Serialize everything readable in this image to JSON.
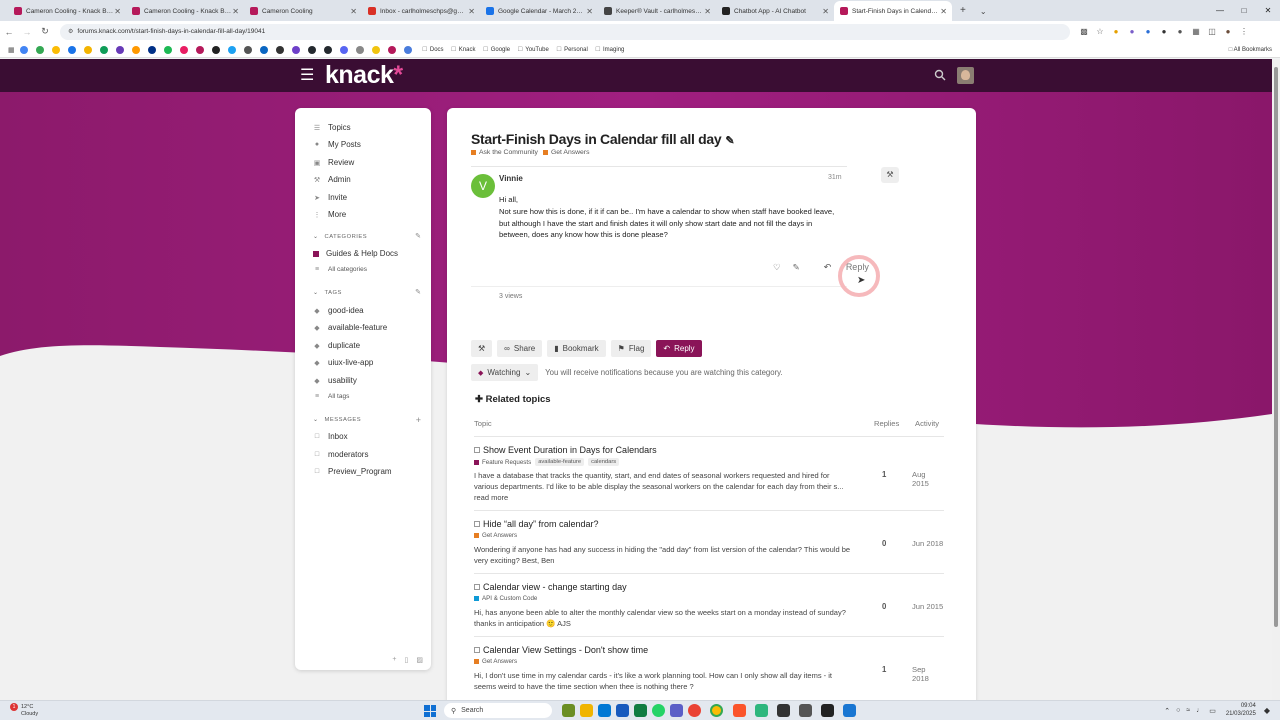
{
  "browser": {
    "tabs": [
      {
        "title": "Cameron Cooling - Knack Buil...",
        "color": "#b5195a"
      },
      {
        "title": "Cameron Cooling - Knack Buil...",
        "color": "#b5195a"
      },
      {
        "title": "Cameron Cooling",
        "color": "#b5195a"
      },
      {
        "title": "Inbox - carlholmeschps@gmail...",
        "color": "#d93025"
      },
      {
        "title": "Google Calendar - March 2025",
        "color": "#1a73e8"
      },
      {
        "title": "Keeper® Vault - carlholmeschp...",
        "color": "#444"
      },
      {
        "title": "Chatbot App - AI Chatbot",
        "color": "#222"
      },
      {
        "title": "Start-Finish Days in Calendar fill",
        "color": "#b5195a"
      }
    ],
    "url": "forums.knack.com/t/start-finish-days-in-calendar-fill-all-day/19041",
    "bookmarks": [
      "Docs",
      "Knack",
      "Google",
      "YouTube",
      "Personal",
      "Imaging"
    ],
    "all_bookmarks": "All Bookmarks"
  },
  "header": {
    "logo": "knack",
    "logo_star": "*"
  },
  "sidebar": {
    "nav": [
      "Topics",
      "My Posts",
      "Review",
      "Admin",
      "Invite",
      "More"
    ],
    "categories_heading": "CATEGORIES",
    "categories": [
      "Guides & Help Docs"
    ],
    "all_categories": "All categories",
    "tags_heading": "TAGS",
    "tags": [
      "good-idea",
      "available-feature",
      "duplicate",
      "uiux-live-app",
      "usability"
    ],
    "all_tags": "All tags",
    "messages_heading": "MESSAGES",
    "messages": [
      "Inbox",
      "moderators",
      "Preview_Program"
    ]
  },
  "topic": {
    "title": "Start-Finish Days in Calendar fill all day",
    "category": "Ask the Community",
    "subcategory": "Get Answers",
    "category_color": "#e67e22",
    "post": {
      "author": "Vinnie",
      "avatar_letter": "V",
      "time": "31m",
      "greeting": "Hi all,",
      "body": "Not sure how this is done, if it if can be.. I'm have a calendar to show when staff have booked leave, but although I have the start and finish dates it will only show start date and not fill the days in between, does any know how this is done please?",
      "reply_label": "Reply",
      "views": "3 views"
    },
    "buttons": {
      "share": "Share",
      "bookmark": "Bookmark",
      "flag": "Flag",
      "reply": "Reply"
    },
    "watching_label": "Watching",
    "watching_text": "You will receive notifications because you are watching this category."
  },
  "related": {
    "heading": "Related topics",
    "columns": {
      "topic": "Topic",
      "replies": "Replies",
      "activity": "Activity"
    },
    "rows": [
      {
        "title": "Show Event Duration in Days for Calendars",
        "category": "Feature Requests",
        "cat_color": "#8a1458",
        "tags": [
          "available-feature",
          "calendars"
        ],
        "excerpt": "I have a database that tracks the quantity, start, and end dates of seasonal workers requested and hired for various departments. I'd like to be able display the seasonal workers on the calendar for each day from their s... read more",
        "replies": "1",
        "activity": "Aug 2015"
      },
      {
        "title": "Hide “all day” from calendar?",
        "category": "Get Answers",
        "cat_color": "#e67e22",
        "tags": [],
        "excerpt": "Wondering if anyone has had any success in hiding the \"add day\" from list version of the calendar? This would be very exciting? Best, Ben",
        "replies": "0",
        "activity": "Jun 2018"
      },
      {
        "title": "Calendar view - change starting day",
        "category": "API & Custom Code",
        "cat_color": "#0e9ad6",
        "tags": [],
        "excerpt": "Hi, has anyone been able to alter the monthly calendar view so the weeks start on a monday instead of sunday? thanks in anticipation 🙂 AJS",
        "replies": "0",
        "activity": "Jun 2015"
      },
      {
        "title": "Calendar View Settings - Don't show time",
        "category": "Get Answers",
        "cat_color": "#e67e22",
        "tags": [],
        "excerpt": "Hi, I don't use time in my calendar cards - it's like a work planning tool. How can I only show all day items - it seems weird to have the time section when thee is nothing there ?",
        "replies": "1",
        "activity": "Sep 2018"
      }
    ]
  },
  "taskbar": {
    "temp": "12°C",
    "weather": "Cloudy",
    "notification_count": "1",
    "search_placeholder": "Search",
    "time": "09:04",
    "date": "21/03/2025"
  }
}
